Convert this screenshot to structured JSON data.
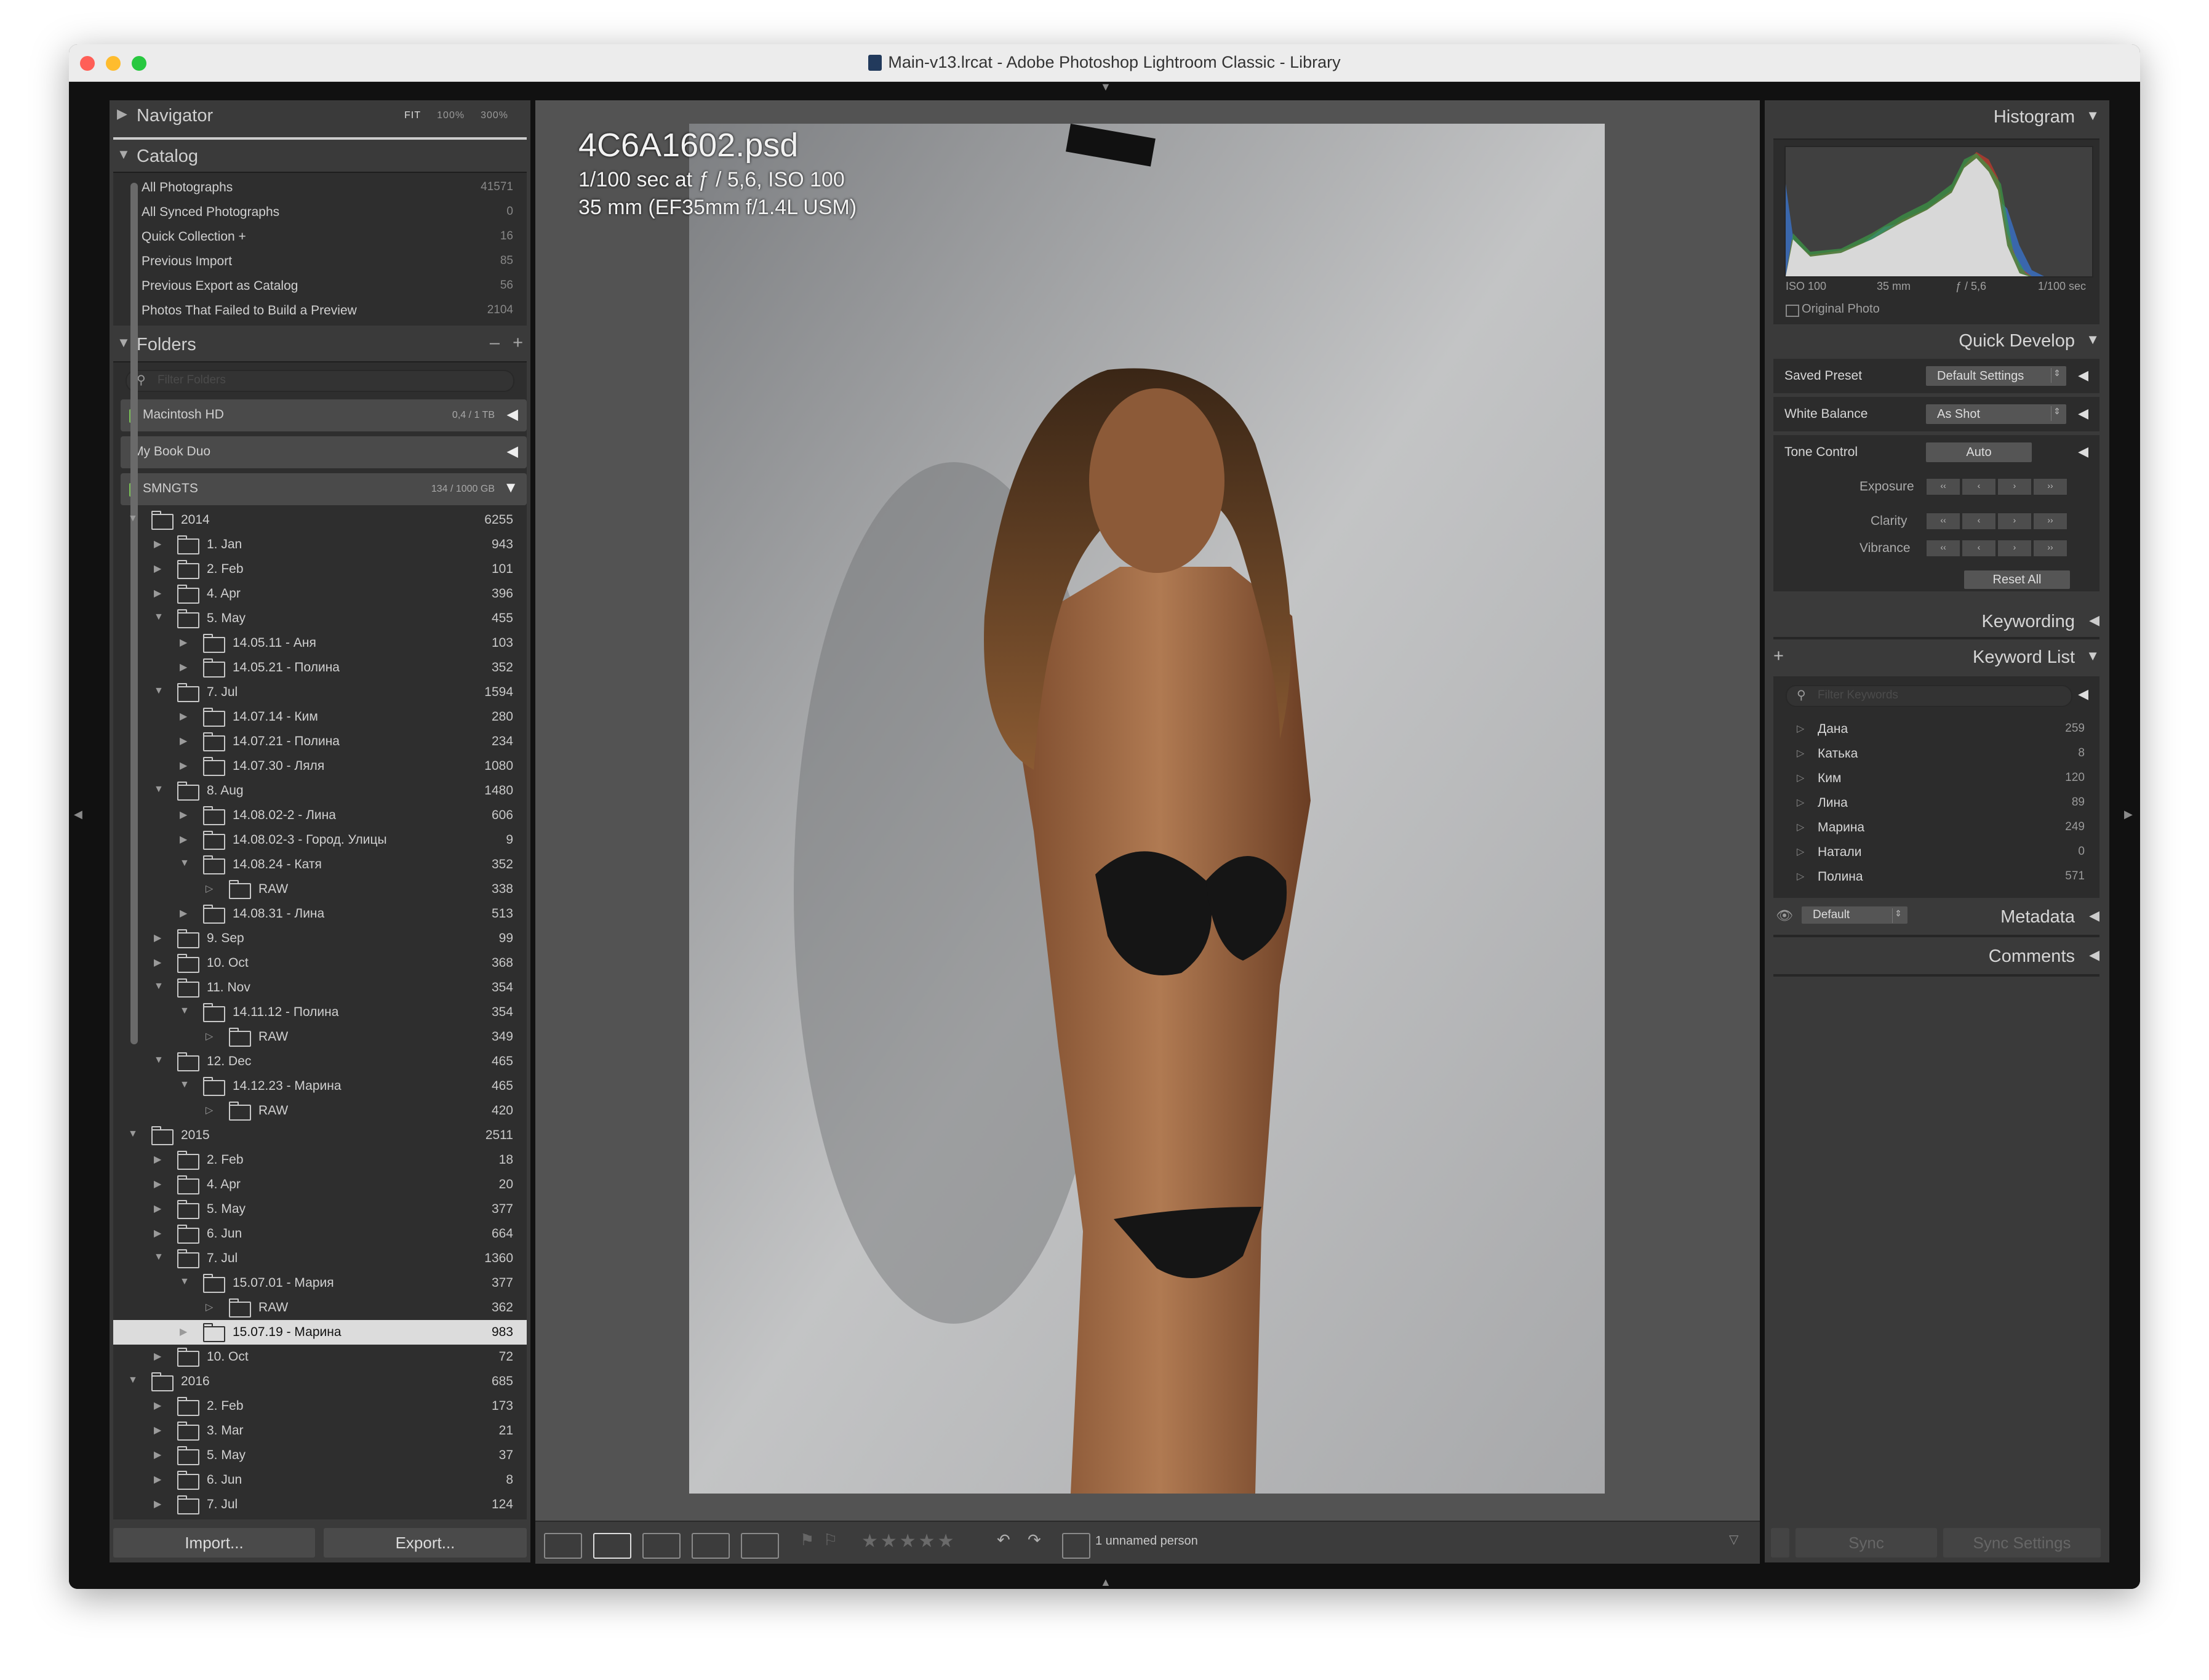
{
  "window": {
    "title": "Main-v13.lrcat - Adobe Photoshop Lightroom Classic - Library"
  },
  "navigator": {
    "label": "Navigator",
    "opts": [
      "FIT",
      "100%",
      "300%"
    ]
  },
  "catalog": {
    "label": "Catalog",
    "items": [
      {
        "label": "All Photographs",
        "count": "41571"
      },
      {
        "label": "All Synced Photographs",
        "count": "0"
      },
      {
        "label": "Quick Collection +",
        "count": "16"
      },
      {
        "label": "Previous Import",
        "count": "85"
      },
      {
        "label": "Previous Export as Catalog",
        "count": "56"
      },
      {
        "label": "Photos That Failed to Build a Preview",
        "count": "2104"
      }
    ]
  },
  "folders": {
    "label": "Folders",
    "actions": [
      "–",
      "+"
    ],
    "filter_placeholder": "Filter Folders",
    "volumes": [
      {
        "name": "Macintosh HD",
        "size": "0,4 / 1 TB"
      },
      {
        "name": "My Book Duo",
        "size": ""
      },
      {
        "name": "SMNGTS",
        "size": "134 / 1000 GB"
      }
    ],
    "tree": [
      {
        "level": 0,
        "open": true,
        "name": "2014",
        "count": "6255"
      },
      {
        "level": 1,
        "open": false,
        "name": "1. Jan",
        "count": "943"
      },
      {
        "level": 1,
        "open": false,
        "name": "2. Feb",
        "count": "101"
      },
      {
        "level": 1,
        "open": false,
        "name": "4. Apr",
        "count": "396"
      },
      {
        "level": 1,
        "open": true,
        "name": "5. May",
        "count": "455"
      },
      {
        "level": 2,
        "open": false,
        "name": "14.05.11 - Аня",
        "count": "103"
      },
      {
        "level": 2,
        "open": false,
        "name": "14.05.21 - Полина",
        "count": "352"
      },
      {
        "level": 1,
        "open": true,
        "name": "7. Jul",
        "count": "1594"
      },
      {
        "level": 2,
        "open": false,
        "name": "14.07.14 - Ким",
        "count": "280"
      },
      {
        "level": 2,
        "open": false,
        "name": "14.07.21 - Полина",
        "count": "234"
      },
      {
        "level": 2,
        "open": false,
        "name": "14.07.30 - Ляля",
        "count": "1080"
      },
      {
        "level": 1,
        "open": true,
        "name": "8. Aug",
        "count": "1480"
      },
      {
        "level": 2,
        "open": false,
        "name": "14.08.02-2 - Лина",
        "count": "606"
      },
      {
        "level": 2,
        "open": false,
        "name": "14.08.02-3 - Город. Улицы",
        "count": "9"
      },
      {
        "level": 2,
        "open": true,
        "name": "14.08.24 - Катя",
        "count": "352"
      },
      {
        "level": 3,
        "open": false,
        "name": "RAW",
        "count": "338"
      },
      {
        "level": 2,
        "open": false,
        "name": "14.08.31 - Лина",
        "count": "513"
      },
      {
        "level": 1,
        "open": false,
        "name": "9. Sep",
        "count": "99"
      },
      {
        "level": 1,
        "open": false,
        "name": "10. Oct",
        "count": "368"
      },
      {
        "level": 1,
        "open": true,
        "name": "11. Nov",
        "count": "354"
      },
      {
        "level": 2,
        "open": true,
        "name": "14.11.12 - Полина",
        "count": "354"
      },
      {
        "level": 3,
        "open": false,
        "name": "RAW",
        "count": "349"
      },
      {
        "level": 1,
        "open": true,
        "name": "12. Dec",
        "count": "465"
      },
      {
        "level": 2,
        "open": true,
        "name": "14.12.23 - Марина",
        "count": "465"
      },
      {
        "level": 3,
        "open": false,
        "name": "RAW",
        "count": "420"
      },
      {
        "level": 0,
        "open": true,
        "name": "2015",
        "count": "2511"
      },
      {
        "level": 1,
        "open": false,
        "name": "2. Feb",
        "count": "18"
      },
      {
        "level": 1,
        "open": false,
        "name": "4. Apr",
        "count": "20"
      },
      {
        "level": 1,
        "open": false,
        "name": "5. May",
        "count": "377"
      },
      {
        "level": 1,
        "open": false,
        "name": "6. Jun",
        "count": "664"
      },
      {
        "level": 1,
        "open": true,
        "name": "7. Jul",
        "count": "1360"
      },
      {
        "level": 2,
        "open": true,
        "name": "15.07.01 - Мария",
        "count": "377"
      },
      {
        "level": 3,
        "open": false,
        "name": "RAW",
        "count": "362"
      },
      {
        "level": 2,
        "open": false,
        "name": "15.07.19 - Марина",
        "count": "983",
        "selected": true
      },
      {
        "level": 1,
        "open": false,
        "name": "10. Oct",
        "count": "72"
      },
      {
        "level": 0,
        "open": true,
        "name": "2016",
        "count": "685"
      },
      {
        "level": 1,
        "open": false,
        "name": "2. Feb",
        "count": "173"
      },
      {
        "level": 1,
        "open": false,
        "name": "3. Mar",
        "count": "21"
      },
      {
        "level": 1,
        "open": false,
        "name": "5. May",
        "count": "37"
      },
      {
        "level": 1,
        "open": false,
        "name": "6. Jun",
        "count": "8"
      },
      {
        "level": 1,
        "open": false,
        "name": "7. Jul",
        "count": "124"
      }
    ]
  },
  "left_buttons": {
    "import": "Import...",
    "export": "Export..."
  },
  "photo": {
    "filename": "4C6A1602.psd",
    "exposure": "1/100 sec at ƒ / 5,6, ISO 100",
    "lens": "35 mm (EF35mm f/1.4L USM)"
  },
  "toolbar": {
    "people": "1 unnamed person",
    "stars": "★★★★★"
  },
  "histogram": {
    "label": "Histogram",
    "iso": "ISO 100",
    "focal": "35 mm",
    "aperture": "ƒ / 5,6",
    "shutter": "1/100 sec",
    "original_photo": "Original Photo"
  },
  "quick_develop": {
    "label": "Quick Develop",
    "saved_preset_label": "Saved Preset",
    "saved_preset_value": "Default Settings",
    "white_balance_label": "White Balance",
    "white_balance_value": "As Shot",
    "tone_control_label": "Tone Control",
    "tone_auto": "Auto",
    "exposure": "Exposure",
    "clarity": "Clarity",
    "vibrance": "Vibrance",
    "reset_all": "Reset All"
  },
  "keywording": {
    "label": "Keywording"
  },
  "keyword_list": {
    "label": "Keyword List",
    "filter_placeholder": "Filter Keywords",
    "items": [
      {
        "name": "Дана",
        "count": "259"
      },
      {
        "name": "Катька",
        "count": "8"
      },
      {
        "name": "Ким",
        "count": "120"
      },
      {
        "name": "Лина",
        "count": "89"
      },
      {
        "name": "Марина",
        "count": "249"
      },
      {
        "name": "Натали",
        "count": "0"
      },
      {
        "name": "Полина",
        "count": "571"
      }
    ]
  },
  "metadata": {
    "label": "Metadata",
    "preset": "Default"
  },
  "comments": {
    "label": "Comments"
  },
  "sync": {
    "sync": "Sync",
    "sync_settings": "Sync Settings"
  }
}
